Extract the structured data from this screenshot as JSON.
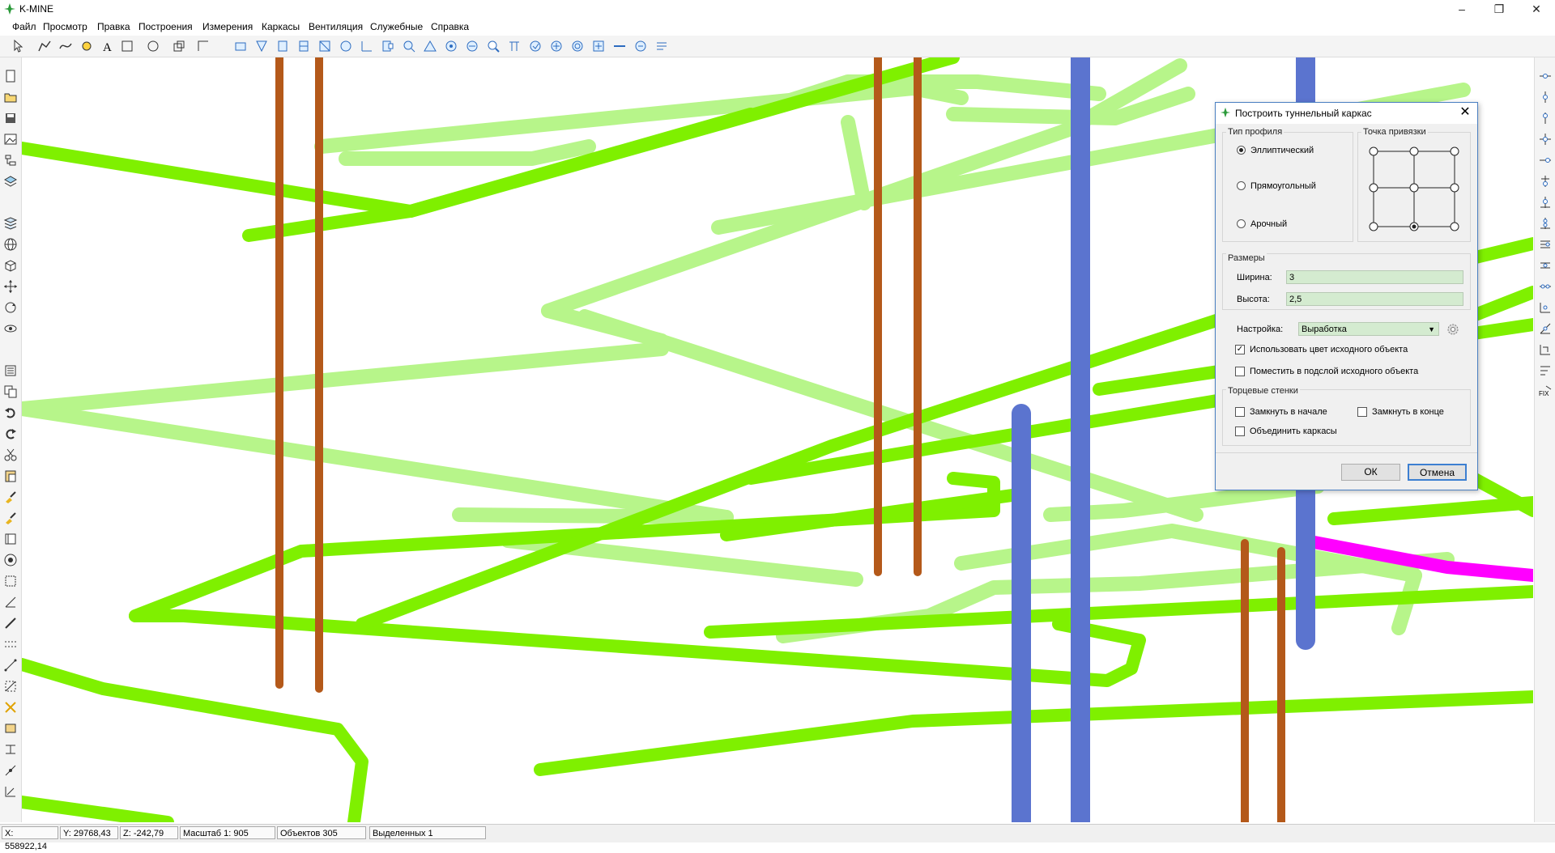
{
  "app": {
    "title": "K-MINE"
  },
  "menu": [
    "Файл",
    "Просмотр",
    "Правка",
    "Построения",
    "Измерения",
    "Каркасы",
    "Вентиляция",
    "Служебные",
    "Справка"
  ],
  "status": {
    "x": "X: 558922,14",
    "y": "Y: 29768,43",
    "z": "Z: -242,79",
    "scale": "Масштаб 1: 905",
    "objects": "Объектов 305",
    "selected": "Выделенных 1"
  },
  "dialog": {
    "title": "Построить туннельный каркас",
    "profile_group": "Тип профиля",
    "profile_options": [
      "Эллиптический",
      "Прямоугольный",
      "Арочный"
    ],
    "profile_selected": "Эллиптический",
    "anchor_group": "Точка привязки",
    "dims_group": "Размеры",
    "width_label": "Ширина:",
    "width_value": "3",
    "height_label": "Высота:",
    "height_value": "2,5",
    "setting_label": "Настройка:",
    "setting_value": "Выработка",
    "use_color_label": "Использовать цвет исходного объекта",
    "use_color_checked": true,
    "sublayer_label": "Поместить в подслой исходного объекта",
    "sublayer_checked": false,
    "walls_group": "Торцевые стенки",
    "close_start_label": "Замкнуть в начале",
    "close_end_label": "Замкнуть в конце",
    "merge_label": "Объединить каркасы",
    "ok_label": "ОК",
    "cancel_label": "Отмена"
  },
  "colors": {
    "tunnel": "#7ff000",
    "tunnel_light": "#b7f58a",
    "vertical_orange": "#b4591a",
    "vertical_blue": "#5b74cf",
    "highlight": "#ff00ff"
  }
}
